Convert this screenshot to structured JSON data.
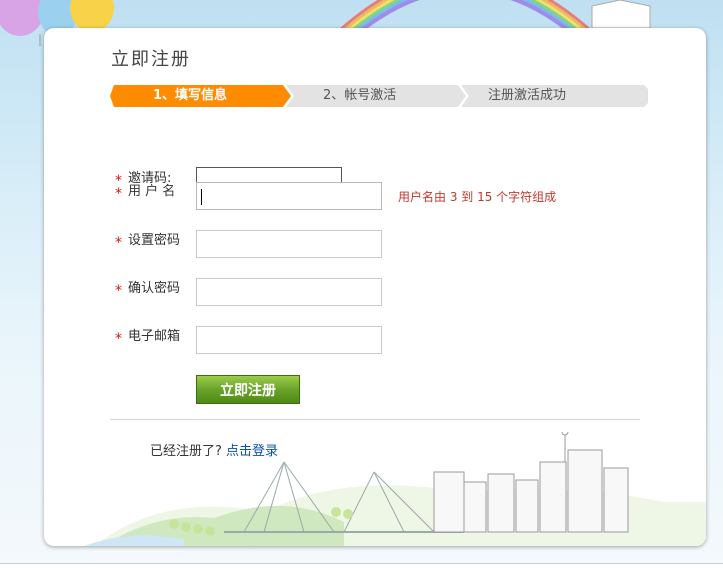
{
  "page": {
    "title": "立即注册"
  },
  "steps": [
    {
      "label": "1、填写信息",
      "state": "active"
    },
    {
      "label": "2、帐号激活",
      "state": "inactive"
    },
    {
      "label": "注册激活成功",
      "state": "inactive"
    }
  ],
  "form": {
    "required_mark": "*",
    "invite_code": {
      "label": "邀请码:",
      "value": ""
    },
    "username": {
      "label": "用 户 名",
      "value": "",
      "hint": "用户名由 3 到 15 个字符组成"
    },
    "password": {
      "label": "设置密码",
      "value": ""
    },
    "confirm_password": {
      "label": "确认密码",
      "value": ""
    },
    "email": {
      "label": "电子邮箱",
      "value": ""
    },
    "submit_label": "立即注册"
  },
  "footer": {
    "already_text": "已经注册了?",
    "login_link": "点击登录"
  },
  "colors": {
    "active_step": "#ff8c00",
    "inactive_step": "#e3e3e3",
    "required": "#dd1111",
    "hint": "#c0392b",
    "submit_button": "#6aa32a",
    "link": "#0a4fa8"
  }
}
